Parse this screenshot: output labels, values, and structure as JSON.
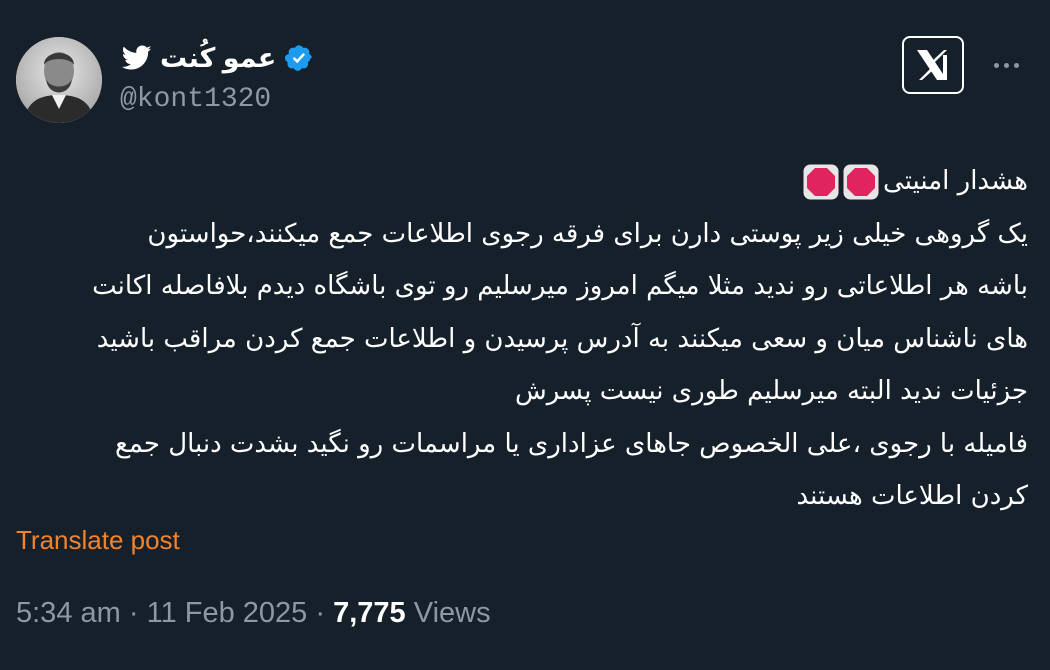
{
  "author": {
    "name": "عمو کُنت",
    "handle": "@kont1320"
  },
  "icons": {
    "bird": "twitter-bird-icon",
    "verified": "verified-badge-icon",
    "logo": "x-logo-icon",
    "more": "more-options-icon",
    "stop": "stop-sign-icon"
  },
  "colors": {
    "background": "#15202b",
    "text": "#ffffff",
    "muted": "#8b98a5",
    "verified": "#1d9bf0",
    "translate": "#f4822a",
    "stop_sign": "#e0245e"
  },
  "tweet": {
    "lines": [
      "هشدار امنیتی",
      "یک گروهی خیلی زیر پوستی دارن برای فرقه رجوی اطلاعات جمع میکنند،حواستون",
      "باشه هر اطلاعاتی رو ندید مثلا میگم امروز میرسلیم رو توی باشگاه دیدم بلافاصله اکانت",
      "های ناشناس میان و سعی میکنند به آدرس پرسیدن و اطلاعات جمع کردن مراقب باشید",
      "جزئیات ندید البته میرسلیم طوری نیست پسرش",
      "فامیله با رجوی ،علی الخصوص جاهای عزاداری یا مراسمات رو نگید بشدت دنبال جمع",
      "کردن اطلاعات هستند"
    ]
  },
  "translate_label": "Translate post",
  "meta": {
    "time": "5:34 am",
    "separator": "·",
    "date": "11 Feb 2025",
    "views_count": "7,775",
    "views_label": "Views"
  }
}
